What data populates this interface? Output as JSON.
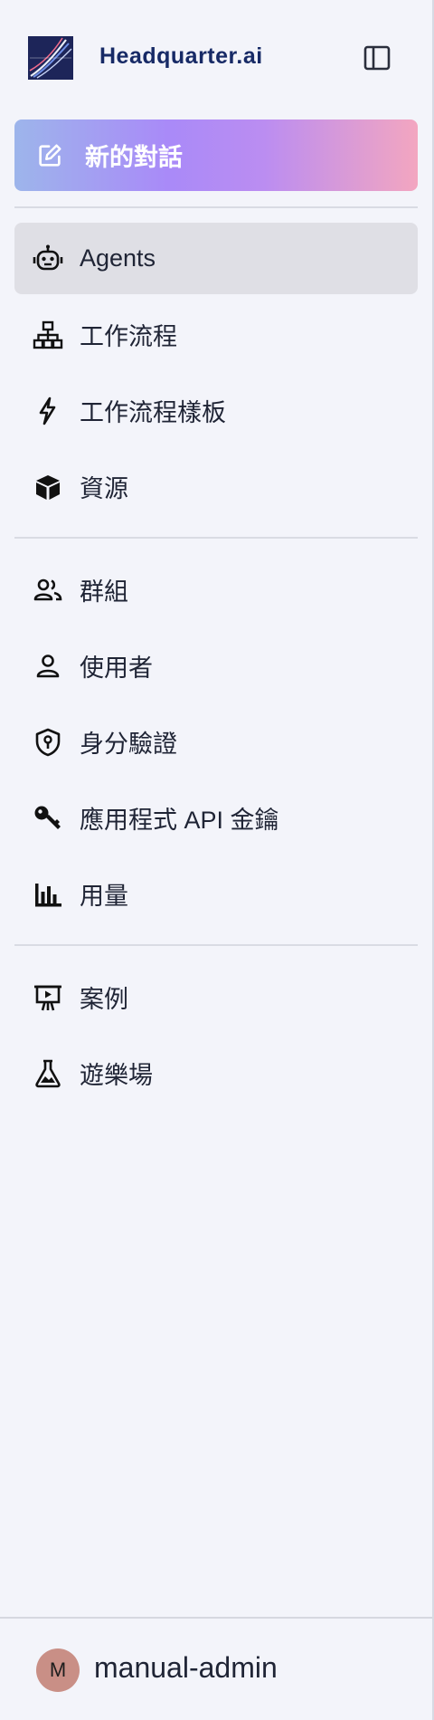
{
  "brand": {
    "name": "Headquarter.ai",
    "logo_icon": "headquarter-logo",
    "brand_color": "#172a66"
  },
  "header": {
    "toggle_icon": "sidebar-panel-icon"
  },
  "new_chat": {
    "label": "新的對話",
    "icon": "edit-square-icon",
    "gradient": [
      "#9db5eb",
      "#a98af8",
      "#bb8df1",
      "#f3a6c0"
    ]
  },
  "nav": {
    "primary": [
      {
        "label": "Agents",
        "icon": "robot-icon",
        "active": true
      },
      {
        "label": "工作流程",
        "icon": "sitemap-icon",
        "active": false
      },
      {
        "label": "工作流程樣板",
        "icon": "lightning-icon",
        "active": false
      },
      {
        "label": "資源",
        "icon": "cube-icon",
        "active": false
      }
    ],
    "admin": [
      {
        "label": "群組",
        "icon": "users-icon"
      },
      {
        "label": "使用者",
        "icon": "user-icon"
      },
      {
        "label": "身分驗證",
        "icon": "shield-key-icon"
      },
      {
        "label": "應用程式 API 金鑰",
        "icon": "key-icon"
      },
      {
        "label": "用量",
        "icon": "bar-chart-icon"
      }
    ],
    "extra": [
      {
        "label": "案例",
        "icon": "presentation-icon"
      },
      {
        "label": "遊樂場",
        "icon": "flask-icon"
      }
    ]
  },
  "user": {
    "avatar_initial": "M",
    "name": "manual-admin",
    "avatar_color": "#c98f86"
  }
}
